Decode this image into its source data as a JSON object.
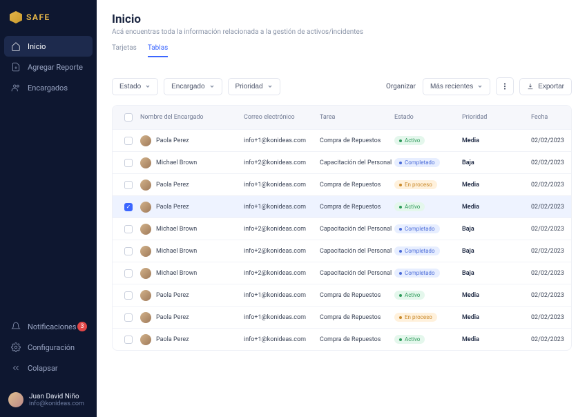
{
  "brand": {
    "name": "SAFE"
  },
  "sidebar": {
    "items": [
      {
        "label": "Inicio",
        "icon": "home"
      },
      {
        "label": "Agregar Reporte",
        "icon": "file-plus"
      },
      {
        "label": "Encargados",
        "icon": "users"
      }
    ],
    "bottom": [
      {
        "label": "Notificaciones",
        "icon": "bell",
        "badge": "3"
      },
      {
        "label": "Configuración",
        "icon": "settings"
      },
      {
        "label": "Colapsar",
        "icon": "collapse"
      }
    ]
  },
  "user": {
    "name": "Juan David Niño",
    "email": "info@konideas.com"
  },
  "header": {
    "title": "Inicio",
    "subtitle": "Acá encuentras toda la información  relacionada a la gestión de activos/incidentes"
  },
  "tabs": [
    {
      "label": "Tarjetas",
      "active": false
    },
    {
      "label": "Tablas",
      "active": true
    }
  ],
  "filters": {
    "estado": "Estado",
    "encargado": "Encargado",
    "prioridad": "Prioridad"
  },
  "toolbar": {
    "organize": "Organizar",
    "sort": "Más recientes",
    "export": "Exportar"
  },
  "table": {
    "headers": {
      "name": "Nombre del Encargado",
      "email": "Correo electrónico",
      "task": "Tarea",
      "status": "Estado",
      "priority": "Prioridad",
      "date": "Fecha"
    },
    "statusLabels": {
      "activo": "Activo",
      "completado": "Completado",
      "proceso": "En proceso"
    },
    "rows": [
      {
        "selected": false,
        "name": "Paola Perez",
        "email": "info+1@konideas.com",
        "task": "Compra de Repuestos",
        "status": "activo",
        "priority": "Media",
        "date": "02/02/2023"
      },
      {
        "selected": false,
        "name": "Michael Brown",
        "email": "info+2@konideas.com",
        "task": "Capacitación del Personal",
        "status": "completado",
        "priority": "Baja",
        "date": "02/02/2023"
      },
      {
        "selected": false,
        "name": "Paola Perez",
        "email": "info+1@konideas.com",
        "task": "Compra de Repuestos",
        "status": "proceso",
        "priority": "Media",
        "date": "02/02/2023"
      },
      {
        "selected": true,
        "name": "Paola Perez",
        "email": "info+1@konideas.com",
        "task": "Compra de Repuestos",
        "status": "activo",
        "priority": "Media",
        "date": "02/02/2023"
      },
      {
        "selected": false,
        "name": "Michael Brown",
        "email": "info+2@konideas.com",
        "task": "Capacitación del Personal",
        "status": "completado",
        "priority": "Baja",
        "date": "02/02/2023"
      },
      {
        "selected": false,
        "name": "Michael Brown",
        "email": "info+2@konideas.com",
        "task": "Capacitación del Personal",
        "status": "completado",
        "priority": "Baja",
        "date": "02/02/2023"
      },
      {
        "selected": false,
        "name": "Michael Brown",
        "email": "info+2@konideas.com",
        "task": "Capacitación del Personal",
        "status": "completado",
        "priority": "Baja",
        "date": "02/02/2023"
      },
      {
        "selected": false,
        "name": "Paola Perez",
        "email": "info+1@konideas.com",
        "task": "Compra de Repuestos",
        "status": "activo",
        "priority": "Media",
        "date": "02/02/2023"
      },
      {
        "selected": false,
        "name": "Paola Perez",
        "email": "info+1@konideas.com",
        "task": "Compra de Repuestos",
        "status": "proceso",
        "priority": "Media",
        "date": "02/02/2023"
      },
      {
        "selected": false,
        "name": "Paola Perez",
        "email": "info+1@konideas.com",
        "task": "Compra de Repuestos",
        "status": "activo",
        "priority": "Media",
        "date": "02/02/2023"
      }
    ]
  }
}
